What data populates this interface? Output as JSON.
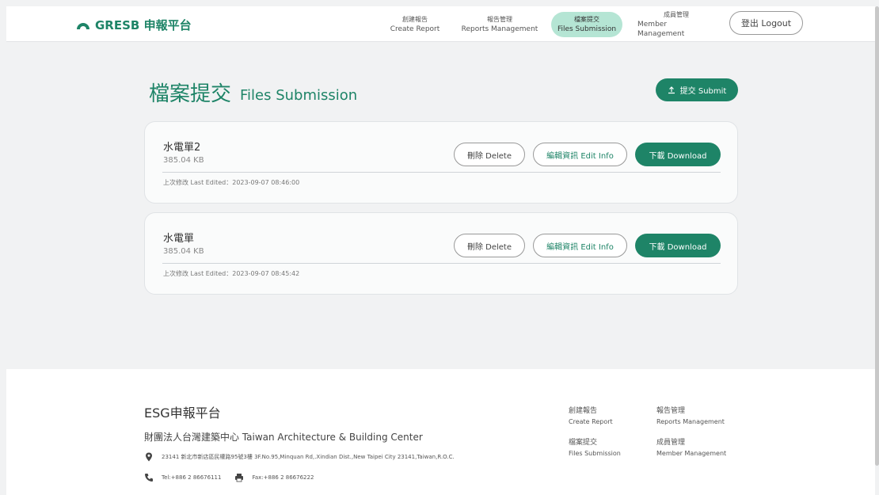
{
  "header": {
    "logo_text": "GRESB 申報平台",
    "nav": [
      {
        "zh": "創建報告",
        "en": "Create Report"
      },
      {
        "zh": "報告管理",
        "en": "Reports Management"
      },
      {
        "zh": "檔案提交",
        "en": "Files Submission"
      },
      {
        "zh": "成員管理",
        "en": "Member Management"
      }
    ],
    "logout_label": "登出 Logout"
  },
  "main": {
    "title_zh": "檔案提交",
    "title_en": "Files Submission",
    "submit_label": "提交 Submit",
    "files": [
      {
        "name": "水電單2",
        "size": "385.04 KB",
        "last_edited": "上次修改 Last Edited：2023-09-07 08:46:00"
      },
      {
        "name": "水電單",
        "size": "385.04 KB",
        "last_edited": "上次修改 Last Edited：2023-09-07 08:45:42"
      }
    ],
    "delete_label": "刪除 Delete",
    "edit_label": "編輯資訊 Edit Info",
    "download_label": "下載 Download"
  },
  "footer": {
    "title": "ESG申報平台",
    "org": "財團法人台灣建築中心 Taiwan Architecture & Building Center",
    "address": "23141 新北市新店區民權路95號3樓 3F.No.95,Minquan Rd,.Xindian Dist.,New Taipei City 23141,Taiwan,R.O.C.",
    "tel": "Tel:+886 2 86676111",
    "fax": "Fax:+886 2 86676222",
    "links": [
      {
        "zh": "創建報告",
        "en": "Create Report"
      },
      {
        "zh": "報告管理",
        "en": "Reports Management"
      },
      {
        "zh": "檔案提交",
        "en": "Files Submission"
      },
      {
        "zh": "成員管理",
        "en": "Member Management"
      }
    ]
  },
  "colors": {
    "accent": "#1e8467",
    "active_nav": "#b5e5d4"
  }
}
